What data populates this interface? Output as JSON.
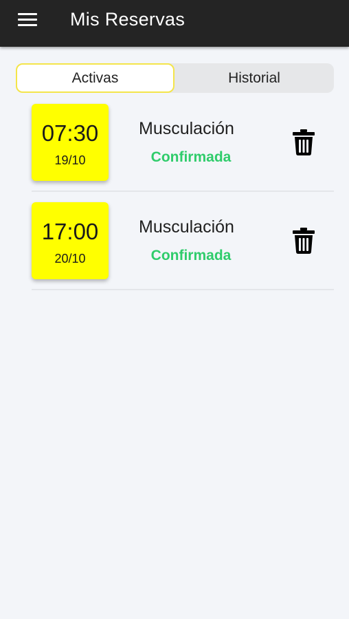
{
  "header": {
    "title": "Mis Reservas",
    "menu_icon": "menu-icon"
  },
  "tabs": [
    {
      "label": "Activas",
      "selected": true
    },
    {
      "label": "Historial",
      "selected": false
    }
  ],
  "bookings": [
    {
      "time": "07:30",
      "date": "19/10",
      "class_name": "Musculación",
      "status": "Confirmada",
      "action_icon": "trash-icon"
    },
    {
      "time": "17:00",
      "date": "20/10",
      "class_name": "Musculación",
      "status": "Confirmada",
      "action_icon": "trash-icon"
    }
  ],
  "colors": {
    "app_bar": "#242424",
    "background": "#f3f5f9",
    "date_card": "#ffff00",
    "status_confirmed": "#2fcc6b",
    "tab_active_border": "#f4e54a"
  }
}
